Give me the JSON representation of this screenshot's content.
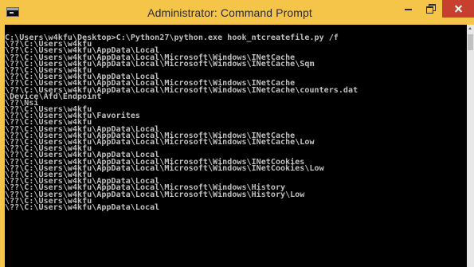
{
  "window": {
    "title": "Administrator: Command Prompt",
    "icon": "cmd-icon",
    "controls": {
      "minimize": "minimize-icon",
      "maximize": "maximize-icon",
      "close": "close-icon"
    }
  },
  "console": {
    "lines": [
      "C:\\Users\\w4kfu\\Desktop>C:\\Python27\\python.exe hook_ntcreatefile.py /f",
      "\\??\\C:\\Users\\w4kfu",
      "\\??\\C:\\Users\\w4kfu\\AppData\\Local",
      "\\??\\C:\\Users\\w4kfu\\AppData\\Local\\Microsoft\\Windows\\INetCache",
      "\\??\\C:\\Users\\w4kfu\\AppData\\Local\\Microsoft\\Windows\\INetCache\\Sqm",
      "\\??\\C:\\Users\\w4kfu",
      "\\??\\C:\\Users\\w4kfu\\AppData\\Local",
      "\\??\\C:\\Users\\w4kfu\\AppData\\Local\\Microsoft\\Windows\\INetCache",
      "\\??\\C:\\Users\\w4kfu\\AppData\\Local\\Microsoft\\Windows\\INetCache\\counters.dat",
      "\\Device\\Afd\\Endpoint",
      "\\??\\Nsi",
      "\\??\\C:\\Users\\w4kfu",
      "\\??\\C:\\Users\\w4kfu\\Favorites",
      "\\??\\C:\\Users\\w4kfu",
      "\\??\\C:\\Users\\w4kfu\\AppData\\Local",
      "\\??\\C:\\Users\\w4kfu\\AppData\\Local\\Microsoft\\Windows\\INetCache",
      "\\??\\C:\\Users\\w4kfu\\AppData\\Local\\Microsoft\\Windows\\INetCache\\Low",
      "\\??\\C:\\Users\\w4kfu",
      "\\??\\C:\\Users\\w4kfu\\AppData\\Local",
      "\\??\\C:\\Users\\w4kfu\\AppData\\Local\\Microsoft\\Windows\\INetCookies",
      "\\??\\C:\\Users\\w4kfu\\AppData\\Local\\Microsoft\\Windows\\INetCookies\\Low",
      "\\??\\C:\\Users\\w4kfu",
      "\\??\\C:\\Users\\w4kfu\\AppData\\Local",
      "\\??\\C:\\Users\\w4kfu\\AppData\\Local\\Microsoft\\Windows\\History",
      "\\??\\C:\\Users\\w4kfu\\AppData\\Local\\Microsoft\\Windows\\History\\Low",
      "\\??\\C:\\Users\\w4kfu",
      "\\??\\C:\\Users\\w4kfu\\AppData\\Local"
    ]
  },
  "colors": {
    "titlebar": "#f5c54a",
    "close_button": "#c7402f",
    "console_background": "#000000",
    "console_text": "#c0c0c0"
  }
}
